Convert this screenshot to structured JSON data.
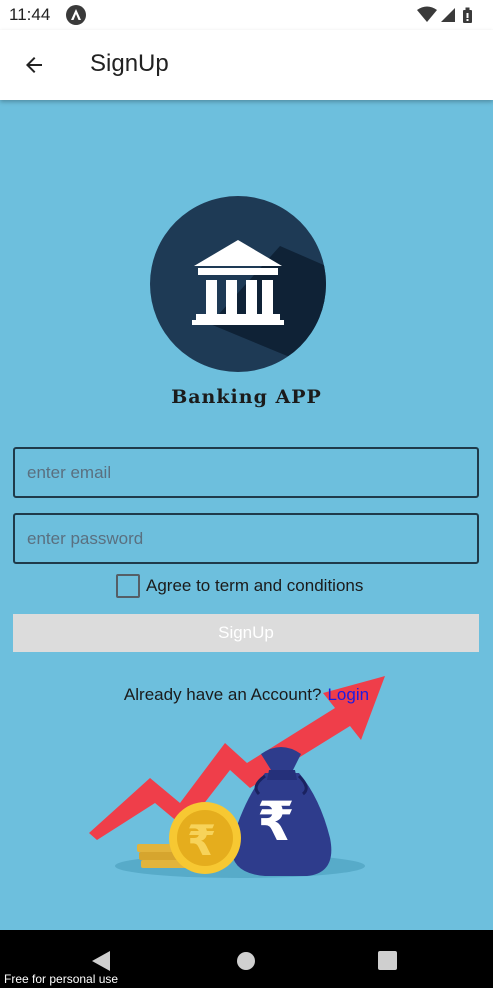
{
  "status_bar": {
    "time": "11:44",
    "notification_icon": "android-studio-icon",
    "wifi_icon": "wifi-icon",
    "signal_icon": "signal-icon",
    "battery_icon": "battery-icon"
  },
  "app_bar": {
    "title": "SignUp",
    "back_icon": "arrow-left-icon"
  },
  "logo": {
    "icon": "bank-building-icon",
    "brand_name": "Banking APP"
  },
  "form": {
    "email_placeholder": "enter email",
    "email_value": "",
    "password_placeholder": "enter password",
    "password_value": "",
    "agree_checked": false,
    "agree_label": "Agree to term and conditions",
    "signup_label": "SignUp"
  },
  "account": {
    "prompt": "Already have an Account?",
    "login_label": "Login"
  },
  "illustration": {
    "icon": "money-bag-growth-icon",
    "currency_symbol": "₹"
  },
  "nav_bar": {
    "back_icon": "nav-back-icon",
    "home_icon": "nav-home-icon",
    "recents_icon": "nav-recents-icon"
  },
  "watermark": "Free for personal use",
  "colors": {
    "background": "#6dbfdd",
    "logo_circle": "#1e3a55",
    "button_disabled": "#dcdcdc",
    "link": "#1e1be0"
  }
}
